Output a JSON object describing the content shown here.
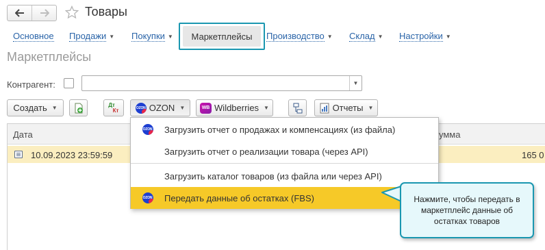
{
  "window": {
    "title": "Товары"
  },
  "sections": [
    {
      "label": "Основное",
      "caret": false
    },
    {
      "label": "Продажи",
      "caret": true
    },
    {
      "label": "Покупки",
      "caret": true
    },
    {
      "label": "Маркетплейсы",
      "caret": false,
      "active": true
    },
    {
      "label": "Производство",
      "caret": true
    },
    {
      "label": "Склад",
      "caret": true
    },
    {
      "label": "Настройки",
      "caret": true
    }
  ],
  "form": {
    "title": "Маркетплейсы",
    "counterparty_label": "Контрагент:",
    "counterparty_value": ""
  },
  "toolbar": {
    "create_label": "Создать",
    "ozon_label": "OZON",
    "wildberries_label": "Wildberries",
    "reports_label": "Отчеты",
    "dt_kt_top": "Дт",
    "dt_kt_bottom": "Кт"
  },
  "table": {
    "columns": [
      "Дата",
      "Сумма"
    ],
    "sum_header_visible": "умма",
    "rows": [
      {
        "date": "10.09.2023 23:59:59",
        "sum_visible": "165 0"
      }
    ]
  },
  "ozon_menu": {
    "items": [
      {
        "label": "Загрузить отчет о продажах и компенсациях (из файла)",
        "icon": "ozon-logo-icon"
      },
      {
        "label": "Загрузить отчет о реализации товара  (через API)",
        "icon": null
      },
      {
        "label": "Загрузить каталог товаров (из файла или через API)",
        "icon": null
      },
      {
        "label": "Передать данные об остатках (FBS)",
        "icon": "ozon-logo-icon",
        "highlighted": true
      }
    ]
  },
  "callout": {
    "text": "Нажмите, чтобы передать в маркетплейс данные об остатках товаров"
  },
  "colors": {
    "link": "#2a64a8",
    "highlight": "#f6c928",
    "callout_border": "#1a97b0",
    "callout_bg": "#e6f8fb",
    "selected_row": "#fbeec0",
    "ozon_blue": "#1d3fd1",
    "wb_purple": "#cb11ab"
  }
}
